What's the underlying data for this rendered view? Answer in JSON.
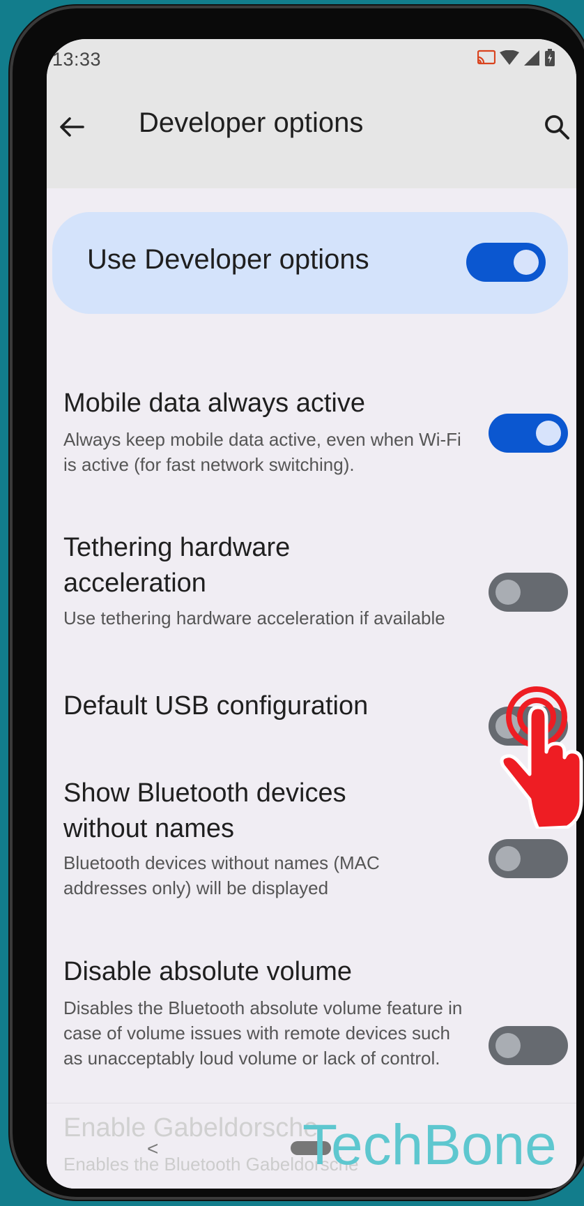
{
  "status_bar": {
    "time": "13:33",
    "icons": [
      "cast-icon",
      "wifi-icon",
      "signal-icon",
      "battery-icon"
    ]
  },
  "app_bar": {
    "title": "Developer options",
    "back_icon": "arrow-back-icon",
    "search_icon": "search-icon"
  },
  "master_switch": {
    "label": "Use Developer options",
    "state": "on"
  },
  "settings": [
    {
      "title": "Mobile data always active",
      "description": "Always keep mobile data active, even when Wi-Fi is active (for fast network switching).",
      "state": "on"
    },
    {
      "title": "Tethering hardware acceleration",
      "description": "Use tethering hardware acceleration if available",
      "state": "off"
    },
    {
      "title": "Default USB configuration",
      "description": "",
      "state": "off"
    },
    {
      "title": "Show Bluetooth devices without names",
      "description": "Bluetooth devices without names (MAC addresses only) will be displayed",
      "state": "off"
    },
    {
      "title": "Disable absolute volume",
      "description": "Disables the Bluetooth absolute volume feature in case of volume issues with remote devices such as unacceptably loud volume or lack of control.",
      "state": "off"
    },
    {
      "title": "Enable Gabeldorsche",
      "description": "Enables the Bluetooth Gabeldorsche",
      "state": "off"
    }
  ],
  "nav_bar": {
    "back_glyph": "<",
    "home_handle": "home-handle"
  },
  "overlay": {
    "watermark": "TechBone",
    "tap_indicator_icon": "tap-hand-icon"
  },
  "colors": {
    "background": "#127d8c",
    "switch_on": "#0b57d0",
    "switch_off": "#666a70",
    "master_card": "#d4e3fb",
    "screen_bg": "#f0edf3",
    "watermark": "#5ec7cf",
    "tap_hand": "#ee1d23"
  }
}
